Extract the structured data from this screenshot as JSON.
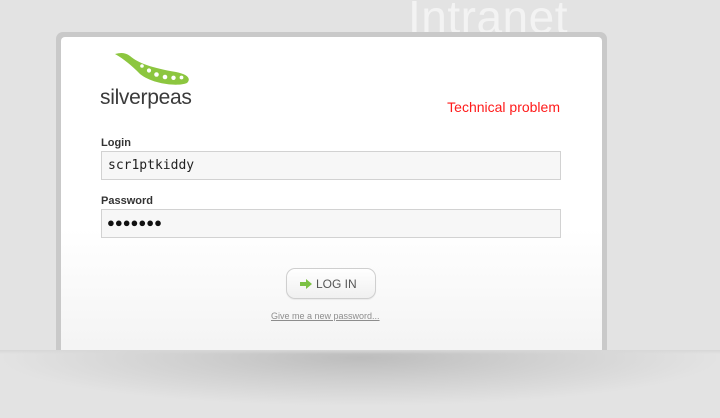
{
  "background_title": "Intranet",
  "logo": {
    "text": "silverpeas"
  },
  "error_message": "Technical problem",
  "login_field": {
    "label": "Login",
    "value": "scr1ptkiddy"
  },
  "password_field": {
    "label": "Password",
    "masked_value": "●●●●●●●"
  },
  "login_button": {
    "label": "LOG IN",
    "icon": "green-arrow-icon"
  },
  "forgot_password_link": "Give me a new password...",
  "colors": {
    "error": "#ff1a1a",
    "logo_green": "#8cc63f",
    "arrow_green": "#7bc143"
  }
}
